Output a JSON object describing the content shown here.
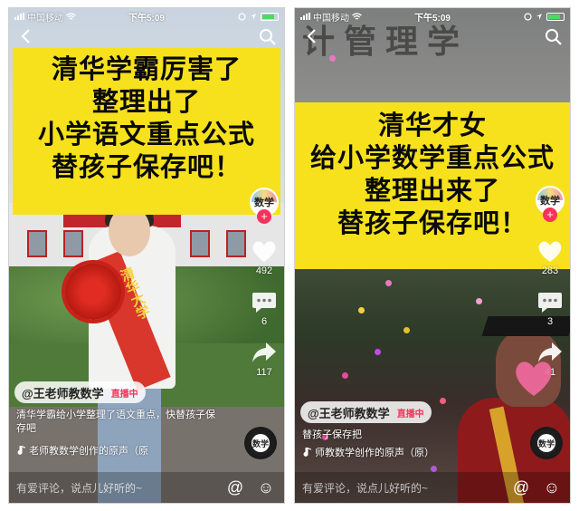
{
  "left_phone": {
    "status": {
      "carrier": "中国移动",
      "time": "下午5:09"
    },
    "banner_lines": [
      "清华学霸厉害了",
      "整理出了",
      "小学语文重点公式",
      "替孩子保存吧！"
    ],
    "sash_text": "清华大学",
    "avatar_label": "数学",
    "likes": "492",
    "comments": "6",
    "shares": "117",
    "author": "@王老师教数学",
    "live_label": "直播中",
    "description": "清华学霸给小学整理了语文重点，快替孩子保存吧",
    "music": "老师教数学创作的原声（原",
    "comment_placeholder": "有爱评论，说点儿好听的~"
  },
  "right_phone": {
    "status": {
      "carrier": "中国移动",
      "time": "下午5:09"
    },
    "wall_text": "计管理学",
    "banner_lines": [
      "清华才女",
      "给小学数学重点公式",
      "整理出来了",
      "替孩子保存吧！"
    ],
    "avatar_label": "数学",
    "likes": "283",
    "comments": "3",
    "shares": "41",
    "author": "@王老师教数学",
    "live_label": "直播中",
    "description": "替孩子保存把",
    "music": "师教数学创作的原声（原）",
    "comment_placeholder": "有爱评论，说点儿好听的~"
  },
  "colors": {
    "banner_yellow": "#f6e11c",
    "follow_red": "#f7325a",
    "battery_green": "#4cd964"
  }
}
